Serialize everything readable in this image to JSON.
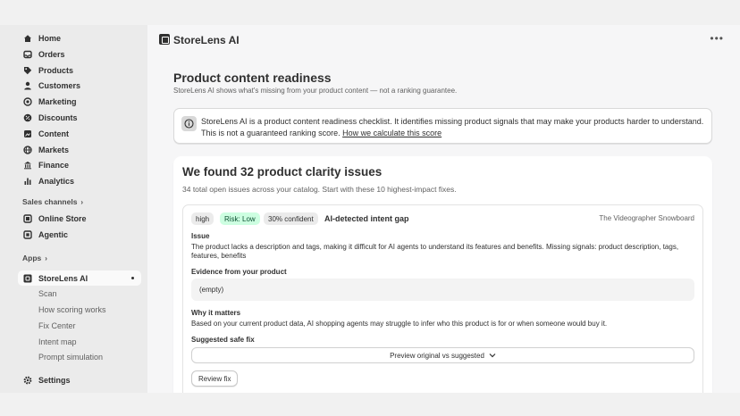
{
  "sidebar": {
    "items": [
      {
        "label": "Home",
        "icon": "home-icon"
      },
      {
        "label": "Orders",
        "icon": "inbox-icon"
      },
      {
        "label": "Products",
        "icon": "tag-icon"
      },
      {
        "label": "Customers",
        "icon": "person-icon"
      },
      {
        "label": "Marketing",
        "icon": "target-icon"
      },
      {
        "label": "Discounts",
        "icon": "discount-icon"
      },
      {
        "label": "Content",
        "icon": "content-icon"
      },
      {
        "label": "Markets",
        "icon": "globe-icon"
      },
      {
        "label": "Finance",
        "icon": "bank-icon"
      },
      {
        "label": "Analytics",
        "icon": "chart-icon"
      }
    ],
    "sales_channels_label": "Sales channels",
    "channels": [
      {
        "label": "Online Store",
        "icon": "store-icon"
      },
      {
        "label": "Agentic",
        "icon": "agentic-icon"
      }
    ],
    "apps_label": "Apps",
    "active_app": {
      "label": "StoreLens AI",
      "icon": "storelens-icon"
    },
    "app_subitems": [
      "Scan",
      "How scoring works",
      "Fix Center",
      "Intent map",
      "Prompt simulation"
    ],
    "settings_label": "Settings"
  },
  "topbar": {
    "app_title": "StoreLens AI",
    "more_label": "•••"
  },
  "page": {
    "title": "Product content readiness",
    "subtitle": "StoreLens AI shows what's missing from your product content — not a ranking guarantee."
  },
  "banner": {
    "text": "StoreLens AI is a product content readiness checklist. It identifies missing product signals that may make your products harder to understand. This is not a guaranteed ranking score.",
    "link": "How we calculate this score"
  },
  "summary": {
    "title": "We found 32 product clarity issues",
    "subtitle": "34 total open issues across your catalog. Start with these 10 highest-impact fixes."
  },
  "issue": {
    "severity": "high",
    "risk": "Risk: Low",
    "confidence": "30% confident",
    "title": "AI-detected intent gap",
    "product": "The Videographer Snowboard",
    "issue_label": "Issue",
    "issue_text": "The product lacks a description and tags, making it difficult for AI agents to understand its features and benefits. Missing signals: product description, tags, features, benefits",
    "evidence_label": "Evidence from your product",
    "evidence_value": "(empty)",
    "why_label": "Why it matters",
    "why_text": "Based on your current product data, AI shopping agents may struggle to infer who this product is for or when someone would buy it.",
    "fix_label": "Suggested safe fix",
    "preview_button": "Preview original vs suggested",
    "review_button": "Review fix"
  },
  "colors": {
    "risk_badge_bg": "#cdfee1",
    "risk_badge_text": "#0c5132",
    "sidebar_bg": "#ebebeb"
  }
}
